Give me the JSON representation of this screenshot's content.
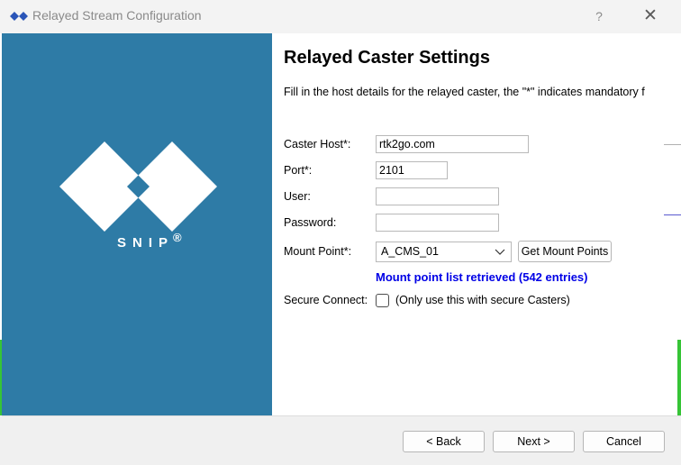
{
  "window": {
    "title": "Relayed Stream Configuration",
    "help_label": "?",
    "close_label": "✕"
  },
  "sidebar": {
    "logo_text": "SNIP",
    "logo_registered": "®",
    "background_color": "#2e7ba6"
  },
  "form": {
    "heading": "Relayed Caster Settings",
    "description": "Fill in the host details for the relayed caster, the \"*\" indicates mandatory f",
    "caster_host": {
      "label": "Caster Host*:",
      "value": "rtk2go.com"
    },
    "port": {
      "label": "Port*:",
      "value": "2101"
    },
    "user": {
      "label": "User:",
      "value": ""
    },
    "password": {
      "label": "Password:",
      "value": ""
    },
    "mount_point": {
      "label": "Mount Point*:",
      "value": "A_CMS_01"
    },
    "get_mount_points_label": "Get Mount Points",
    "status_text": "Mount point list retrieved (542 entries)",
    "status_color": "#0000e6",
    "secure_connect": {
      "label": "Secure Connect:",
      "checked": false,
      "note": "(Only use this with secure Casters)"
    }
  },
  "footer": {
    "back_label": "< Back",
    "next_label": "Next >",
    "cancel_label": "Cancel"
  }
}
